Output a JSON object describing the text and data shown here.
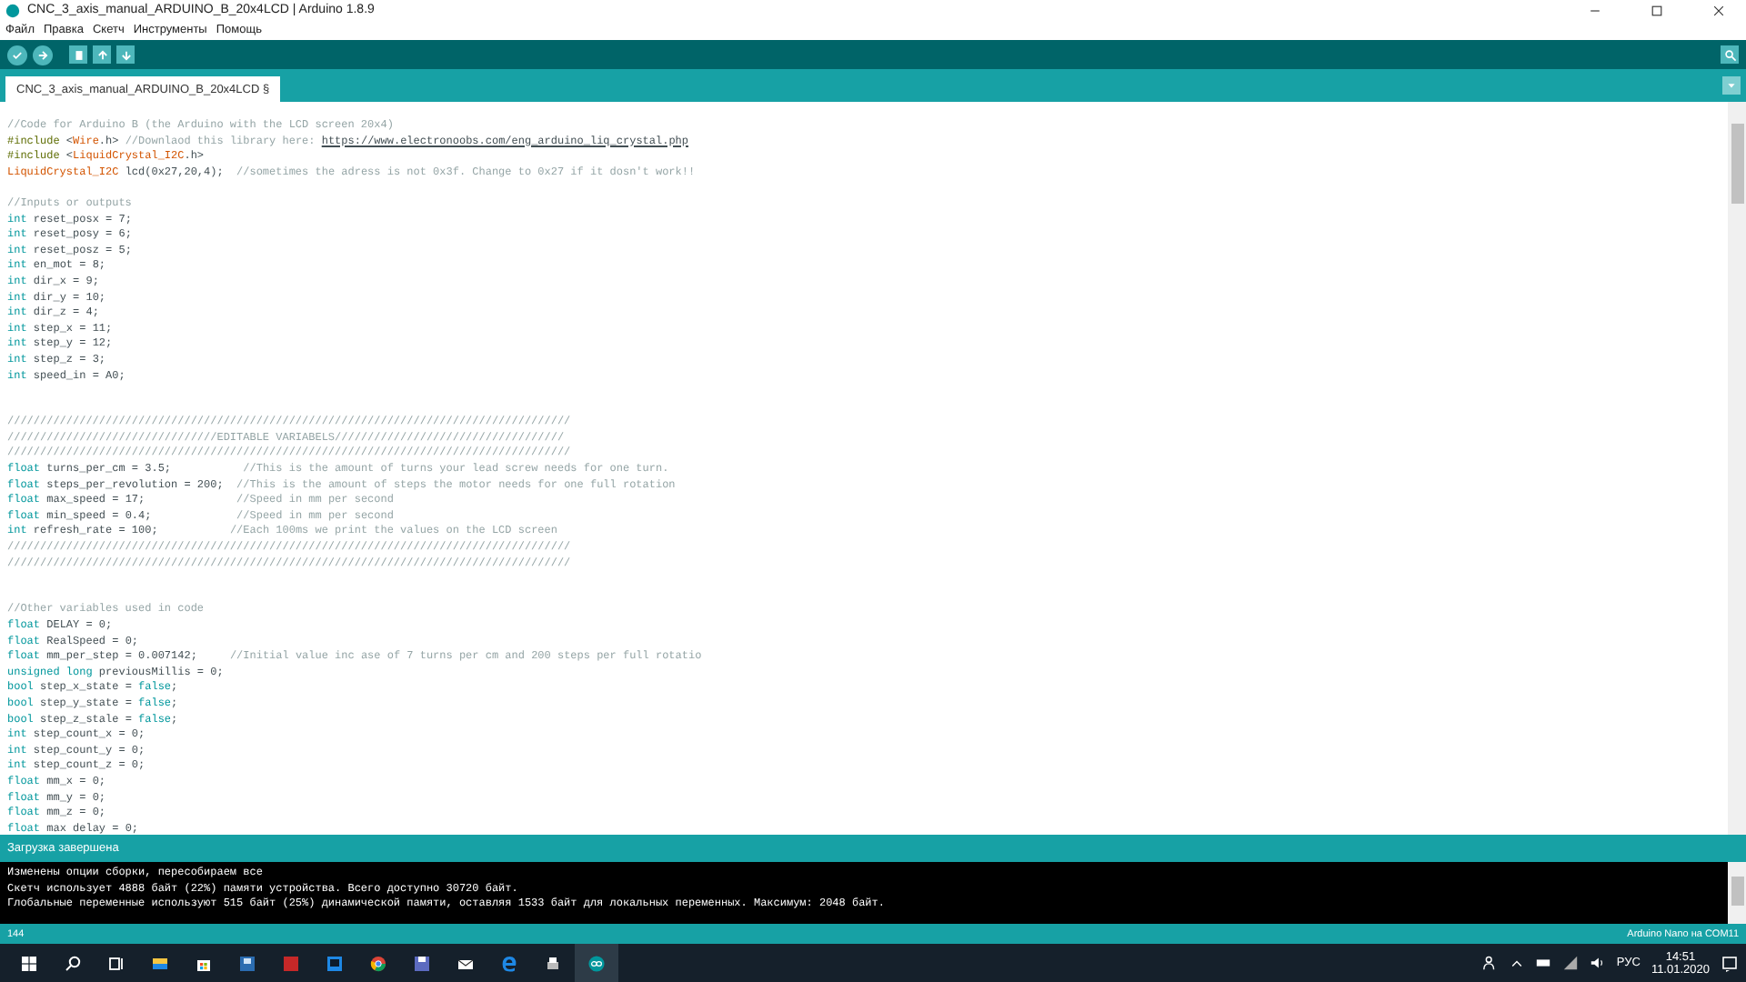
{
  "window": {
    "title": "CNC_3_axis_manual_ARDUINO_B_20x4LCD | Arduino 1.8.9"
  },
  "menu": [
    "Файл",
    "Правка",
    "Скетч",
    "Инструменты",
    "Помощь"
  ],
  "tabs": [
    {
      "label": "CNC_3_axis_manual_ARDUINO_B_20x4LCD §",
      "selected": true
    }
  ],
  "code_blocks": [
    {
      "lines": [
        [
          {
            "kind": "comment",
            "text": "//Code for Arduino B (the Arduino with the LCD screen 20x4)"
          }
        ],
        [
          {
            "kind": "preproc",
            "text": "#include "
          },
          {
            "kind": "plain",
            "text": "<"
          },
          {
            "kind": "lib",
            "text": "Wire"
          },
          {
            "kind": "plain",
            "text": ".h> "
          },
          {
            "kind": "comment",
            "text": "//Downlaod this library here: "
          },
          {
            "kind": "link",
            "text": "https://www.electronoobs.com/eng_arduino_liq_crystal.php"
          }
        ],
        [
          {
            "kind": "preproc",
            "text": "#include "
          },
          {
            "kind": "plain",
            "text": "<"
          },
          {
            "kind": "lib",
            "text": "LiquidCrystal_I2C"
          },
          {
            "kind": "plain",
            "text": ".h>"
          }
        ],
        [
          {
            "kind": "lib",
            "text": "LiquidCrystal_I2C"
          },
          {
            "kind": "plain",
            "text": " lcd(0x27,20,4);  "
          },
          {
            "kind": "comment",
            "text": "//sometimes the adress is not 0x3f. Change to 0x27 if it dosn't work!!"
          }
        ]
      ]
    },
    {
      "kind": "paragraph",
      "lines": [
        [
          {
            "kind": "comment",
            "text": "//Inputs or outputs"
          }
        ],
        [
          {
            "kind": "type",
            "text": "int"
          },
          {
            "kind": "plain",
            "text": " reset_posx = 7;"
          }
        ],
        [
          {
            "kind": "type",
            "text": "int"
          },
          {
            "kind": "plain",
            "text": " reset_posy = 6;"
          }
        ],
        [
          {
            "kind": "type",
            "text": "int"
          },
          {
            "kind": "plain",
            "text": " reset_posz = 5;"
          }
        ],
        [
          {
            "kind": "type",
            "text": "int"
          },
          {
            "kind": "plain",
            "text": " en_mot = 8;"
          }
        ],
        [
          {
            "kind": "type",
            "text": "int"
          },
          {
            "kind": "plain",
            "text": " dir_x = 9;"
          }
        ],
        [
          {
            "kind": "type",
            "text": "int"
          },
          {
            "kind": "plain",
            "text": " dir_y = 10;"
          }
        ],
        [
          {
            "kind": "type",
            "text": "int"
          },
          {
            "kind": "plain",
            "text": " dir_z = 4;"
          }
        ],
        [
          {
            "kind": "type",
            "text": "int"
          },
          {
            "kind": "plain",
            "text": " step_x = 11;"
          }
        ],
        [
          {
            "kind": "type",
            "text": "int"
          },
          {
            "kind": "plain",
            "text": " step_y = 12;"
          }
        ],
        [
          {
            "kind": "type",
            "text": "int"
          },
          {
            "kind": "plain",
            "text": " step_z = 3;"
          }
        ],
        [
          {
            "kind": "type",
            "text": "int"
          },
          {
            "kind": "plain",
            "text": " speed_in = A0;"
          }
        ]
      ]
    },
    {
      "kind": "section",
      "lines": [
        [
          {
            "kind": "comment",
            "text": "//////////////////////////////////////////////////////////////////////////////////////"
          }
        ],
        [
          {
            "kind": "comment",
            "text": "////////////////////////////////EDITABLE VARIABELS///////////////////////////////////"
          }
        ],
        [
          {
            "kind": "comment",
            "text": "//////////////////////////////////////////////////////////////////////////////////////"
          }
        ],
        [
          {
            "kind": "type",
            "text": "float"
          },
          {
            "kind": "plain",
            "text": " turns_per_cm = 3.5;           "
          },
          {
            "kind": "comment",
            "text": "//This is the amount of turns your lead screw needs for one turn."
          }
        ],
        [
          {
            "kind": "type",
            "text": "float"
          },
          {
            "kind": "plain",
            "text": " steps_per_revolution = 200;  "
          },
          {
            "kind": "comment",
            "text": "//This is the amount of steps the motor needs for one full rotation"
          }
        ],
        [
          {
            "kind": "type",
            "text": "float"
          },
          {
            "kind": "plain",
            "text": " max_speed = 17;              "
          },
          {
            "kind": "comment",
            "text": "//Speed in mm per second"
          }
        ],
        [
          {
            "kind": "type",
            "text": "float"
          },
          {
            "kind": "plain",
            "text": " min_speed = 0.4;             "
          },
          {
            "kind": "comment",
            "text": "//Speed in mm per second"
          }
        ],
        [
          {
            "kind": "type",
            "text": "int"
          },
          {
            "kind": "plain",
            "text": " refresh_rate = 100;           "
          },
          {
            "kind": "comment",
            "text": "//Each 100ms we print the values on the LCD screen"
          }
        ],
        [
          {
            "kind": "comment",
            "text": "//////////////////////////////////////////////////////////////////////////////////////"
          }
        ],
        [
          {
            "kind": "comment",
            "text": "//////////////////////////////////////////////////////////////////////////////////////"
          }
        ]
      ]
    },
    {
      "kind": "section",
      "lines": [
        [
          {
            "kind": "comment",
            "text": "//Other variables used in code"
          }
        ],
        [
          {
            "kind": "type",
            "text": "float"
          },
          {
            "kind": "plain",
            "text": " DELAY = 0;"
          }
        ],
        [
          {
            "kind": "type",
            "text": "float"
          },
          {
            "kind": "plain",
            "text": " RealSpeed = 0;"
          }
        ],
        [
          {
            "kind": "type",
            "text": "float"
          },
          {
            "kind": "plain",
            "text": " mm_per_step = 0.007142;     "
          },
          {
            "kind": "comment",
            "text": "//Initial value inc ase of 7 turns per cm and 200 steps per full rotatio"
          }
        ],
        [
          {
            "kind": "type",
            "text": "unsigned long"
          },
          {
            "kind": "plain",
            "text": " previousMillis = 0;"
          }
        ],
        [
          {
            "kind": "type",
            "text": "bool"
          },
          {
            "kind": "plain",
            "text": " step_x_state = "
          },
          {
            "kind": "type",
            "text": "false"
          },
          {
            "kind": "plain",
            "text": ";"
          }
        ],
        [
          {
            "kind": "type",
            "text": "bool"
          },
          {
            "kind": "plain",
            "text": " step_y_state = "
          },
          {
            "kind": "type",
            "text": "false"
          },
          {
            "kind": "plain",
            "text": ";"
          }
        ],
        [
          {
            "kind": "type",
            "text": "bool"
          },
          {
            "kind": "plain",
            "text": " step_z_stale = "
          },
          {
            "kind": "type",
            "text": "false"
          },
          {
            "kind": "plain",
            "text": ";"
          }
        ],
        [
          {
            "kind": "type",
            "text": "int"
          },
          {
            "kind": "plain",
            "text": " step_count_x = 0;"
          }
        ],
        [
          {
            "kind": "type",
            "text": "int"
          },
          {
            "kind": "plain",
            "text": " step_count_y = 0;"
          }
        ],
        [
          {
            "kind": "type",
            "text": "int"
          },
          {
            "kind": "plain",
            "text": " step_count_z = 0;"
          }
        ],
        [
          {
            "kind": "type",
            "text": "float"
          },
          {
            "kind": "plain",
            "text": " mm_x = 0;"
          }
        ],
        [
          {
            "kind": "type",
            "text": "float"
          },
          {
            "kind": "plain",
            "text": " mm_y = 0;"
          }
        ],
        [
          {
            "kind": "type",
            "text": "float"
          },
          {
            "kind": "plain",
            "text": " mm_z = 0;"
          }
        ],
        [
          {
            "kind": "type",
            "text": "float"
          },
          {
            "kind": "plain",
            "text": " max delay = 0;"
          }
        ]
      ]
    }
  ],
  "status_message": "Загрузка завершена",
  "console_lines": [
    "Изменены опции сборки, пересобираем все",
    "Скетч использует 4888 байт (22%) памяти устройства. Всего доступно 30720 байт.",
    "Глобальные переменные используют 515 байт (25%) динамической памяти, оставляя 1533 байт для локальных переменных. Максимум: 2048 байт."
  ],
  "footer": {
    "line_number": "144",
    "board": "Arduino Nano на COM11"
  },
  "taskbar": {
    "language": "РУС",
    "time": "14:51",
    "date": "11.01.2020"
  }
}
